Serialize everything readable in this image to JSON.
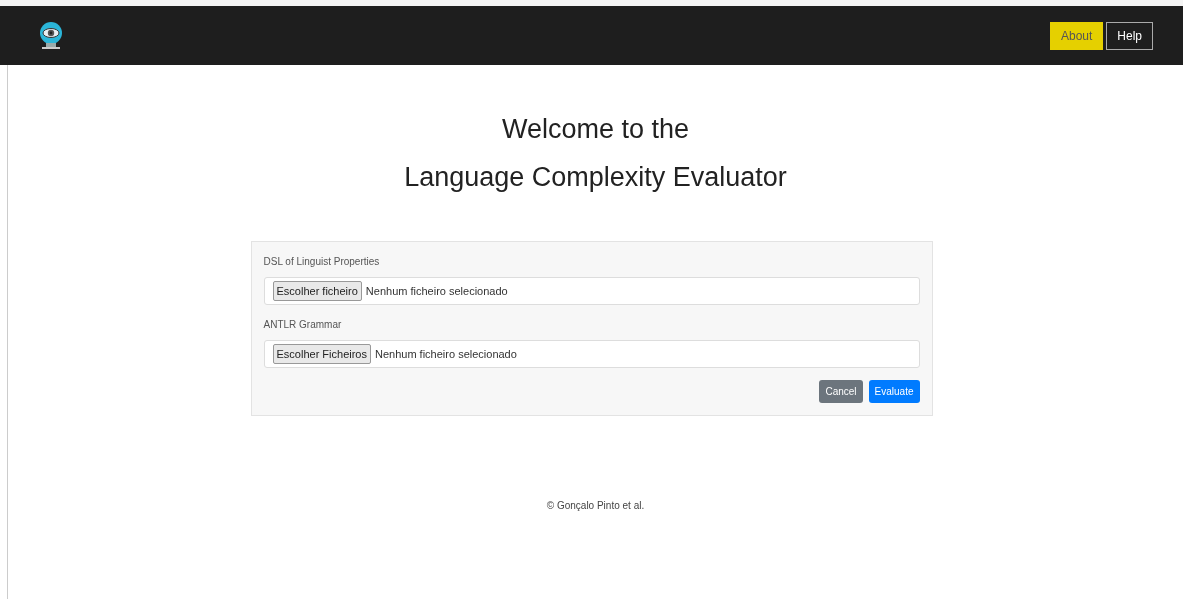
{
  "navbar": {
    "links": [
      {
        "label": "About",
        "selected": true
      },
      {
        "label": "Help",
        "selected": false
      }
    ]
  },
  "heading": [
    "Welcome to the",
    "Language Complexity Evaluator"
  ],
  "form": {
    "fields": [
      {
        "label": "DSL of Linguist Properties",
        "button": "Escolher ficheiro",
        "status": "Nenhum ficheiro selecionado"
      },
      {
        "label": "ANTLR Grammar",
        "button": "Escolher Ficheiros",
        "status": "Nenhum ficheiro selecionado"
      }
    ],
    "buttons": [
      {
        "kind": "secondary",
        "label": "Cancel"
      },
      {
        "kind": "primary",
        "label": "Evaluate"
      }
    ]
  },
  "footer": "© Gonçalo Pinto et al."
}
